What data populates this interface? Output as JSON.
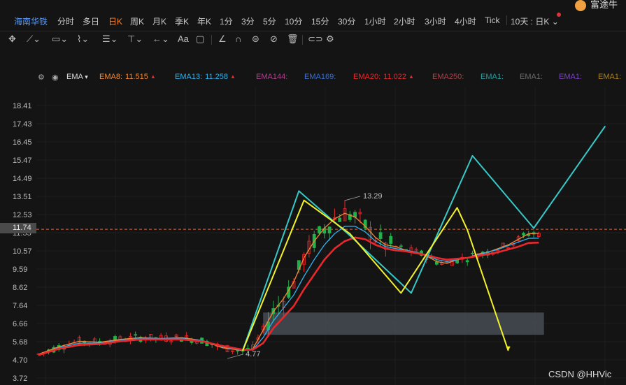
{
  "header": {
    "stock_name": "海南华铁",
    "periods": [
      "分时",
      "多日",
      "日K",
      "周K",
      "月K",
      "季K",
      "年K",
      "1分",
      "3分",
      "5分",
      "10分",
      "15分",
      "30分",
      "1小时",
      "2小时",
      "3小时",
      "4小时",
      "Tick"
    ],
    "active_period": "日K",
    "range_selector": "10天 : 日K",
    "user_name": "富途牛"
  },
  "toolbar": {
    "icons": [
      "move-icon",
      "line-tool-icon",
      "rect-tool-icon",
      "wave-tool-icon",
      "fib-tool-icon",
      "vertical-line-icon",
      "arrow-tool-icon",
      "text-tool-icon",
      "comment-icon",
      "angle-tool-icon",
      "magnet-icon",
      "lock-icon",
      "hide-icon",
      "trash-icon",
      "link-icon",
      "settings-icon"
    ],
    "text_label": "Aa"
  },
  "indicator_bar": {
    "name": "EMA",
    "items": [
      {
        "label": "EMA8:",
        "value": "11.515",
        "color": "#f08a38",
        "arrow": "▲"
      },
      {
        "label": "EMA13:",
        "value": "11.258",
        "color": "#2fb2ef",
        "arrow": "▲"
      },
      {
        "label": "EMA144:",
        "value": "",
        "color": "#b0428e",
        "arrow": ""
      },
      {
        "label": "EMA169:",
        "value": "",
        "color": "#3f6fc8",
        "arrow": ""
      },
      {
        "label": "EMA20:",
        "value": "11.022",
        "color": "#e8282c",
        "arrow": "▲"
      },
      {
        "label": "EMA250:",
        "value": "",
        "color": "#a8424a",
        "arrow": ""
      },
      {
        "label": "EMA1:",
        "value": "",
        "color": "#2f9a9e",
        "arrow": ""
      },
      {
        "label": "EMA1:",
        "value": "",
        "color": "#6a6a6a",
        "arrow": ""
      },
      {
        "label": "EMA1:",
        "value": "",
        "color": "#7a46b8",
        "arrow": ""
      },
      {
        "label": "EMA1:",
        "value": "",
        "color": "#a8822a",
        "arrow": ""
      }
    ]
  },
  "current_price": "11.74",
  "watermark": "CSDN @HHVic",
  "chart_data": {
    "type": "line",
    "title": "",
    "ylim": [
      3.72,
      18.41
    ],
    "y_ticks": [
      "18.41",
      "17.43",
      "16.45",
      "15.47",
      "14.49",
      "13.51",
      "12.53",
      "11.55",
      "10.57",
      "9.59",
      "8.62",
      "7.64",
      "6.66",
      "5.68",
      "4.70",
      "3.72"
    ],
    "annotations": [
      {
        "text": "13.29",
        "x_index": 60,
        "y": 13.29
      },
      {
        "text": "4.77",
        "x_index": 37,
        "y": 4.77
      }
    ],
    "current_price_line": 11.74,
    "support_zone": {
      "y_low": 6.05,
      "y_high": 7.25,
      "x_start_index": 44,
      "x_end_index": 99
    },
    "series": [
      {
        "name": "EMA8",
        "color": "#f08a38",
        "x": [
          0,
          4,
          8,
          12,
          16,
          20,
          24,
          28,
          32,
          36,
          40,
          42,
          44,
          46,
          48,
          50,
          52,
          54,
          56,
          58,
          60,
          62,
          64,
          66,
          68,
          70,
          72,
          74,
          76,
          78,
          80,
          82,
          84,
          86,
          88,
          90,
          92,
          94,
          96,
          98
        ],
        "values": [
          5.0,
          5.4,
          5.7,
          5.65,
          5.8,
          5.9,
          5.85,
          5.9,
          5.75,
          5.35,
          5.2,
          5.3,
          6.3,
          7.3,
          8.0,
          8.9,
          10.2,
          11.1,
          11.8,
          12.3,
          12.6,
          12.4,
          11.9,
          11.3,
          10.9,
          10.8,
          10.6,
          10.5,
          10.3,
          10.0,
          9.9,
          10.1,
          10.2,
          10.4,
          10.5,
          10.7,
          10.9,
          11.2,
          11.5,
          11.52
        ]
      },
      {
        "name": "EMA13",
        "color": "#2fb2ef",
        "x": [
          0,
          4,
          8,
          12,
          16,
          20,
          24,
          28,
          32,
          36,
          40,
          42,
          44,
          46,
          48,
          50,
          52,
          54,
          56,
          58,
          60,
          62,
          64,
          66,
          68,
          70,
          72,
          74,
          76,
          78,
          80,
          82,
          84,
          86,
          88,
          90,
          92,
          94,
          96,
          98
        ],
        "values": [
          4.95,
          5.35,
          5.6,
          5.6,
          5.75,
          5.85,
          5.85,
          5.85,
          5.75,
          5.4,
          5.22,
          5.25,
          5.9,
          6.8,
          7.5,
          8.2,
          9.2,
          10.1,
          10.9,
          11.5,
          11.9,
          11.9,
          11.6,
          11.1,
          10.8,
          10.7,
          10.6,
          10.5,
          10.35,
          10.1,
          10.0,
          10.1,
          10.2,
          10.35,
          10.5,
          10.65,
          10.85,
          11.05,
          11.25,
          11.26
        ]
      },
      {
        "name": "EMA20",
        "color": "#e8282c",
        "x": [
          0,
          4,
          8,
          12,
          16,
          20,
          24,
          28,
          32,
          36,
          40,
          42,
          44,
          46,
          48,
          50,
          52,
          54,
          56,
          58,
          60,
          62,
          64,
          66,
          68,
          70,
          72,
          74,
          76,
          78,
          80,
          82,
          84,
          86,
          88,
          90,
          92,
          94,
          96,
          98
        ],
        "values": [
          4.95,
          5.3,
          5.5,
          5.55,
          5.7,
          5.8,
          5.8,
          5.8,
          5.7,
          5.45,
          5.25,
          5.25,
          5.6,
          6.4,
          7.0,
          7.6,
          8.5,
          9.3,
          10.1,
          10.7,
          11.1,
          11.3,
          11.2,
          10.9,
          10.7,
          10.6,
          10.55,
          10.45,
          10.35,
          10.2,
          10.1,
          10.15,
          10.2,
          10.3,
          10.4,
          10.5,
          10.65,
          10.8,
          11.0,
          11.02
        ]
      },
      {
        "name": "Cyan wave",
        "color": "#37c8c8",
        "x": [
          40,
          51,
          61,
          73,
          85,
          97,
          111
        ],
        "values": [
          5.2,
          13.8,
          11.4,
          8.3,
          15.7,
          11.8,
          17.3
        ]
      },
      {
        "name": "Yellow wave",
        "color": "#f2f22a",
        "x": [
          40,
          52,
          61,
          71,
          82,
          84,
          92
        ],
        "values": [
          5.2,
          13.3,
          11.5,
          8.3,
          12.9,
          11.7,
          5.2
        ]
      }
    ]
  }
}
